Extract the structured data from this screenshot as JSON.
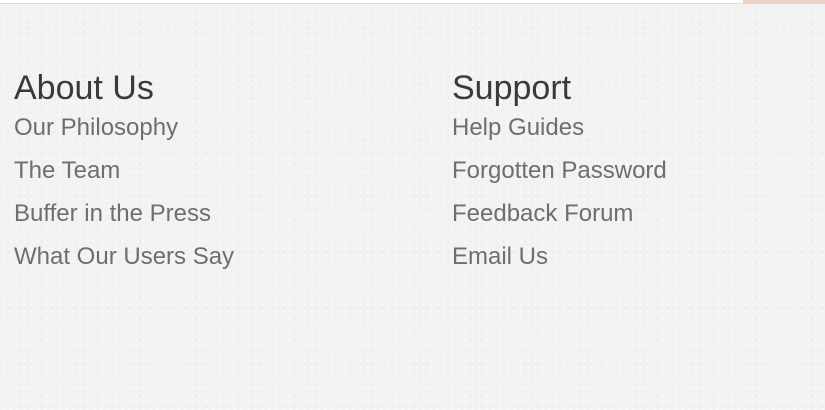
{
  "about": {
    "heading": "About Us",
    "links": [
      "Our Philosophy",
      "The Team",
      "Buffer in the Press",
      "What Our Users Say"
    ]
  },
  "support": {
    "heading": "Support",
    "links": [
      "Help Guides",
      "Forgotten Password",
      "Feedback Forum",
      "Email Us"
    ]
  },
  "colors": {
    "background": "#f2f2f2",
    "heading": "#3a3a3a",
    "link": "#6e6e6e"
  }
}
